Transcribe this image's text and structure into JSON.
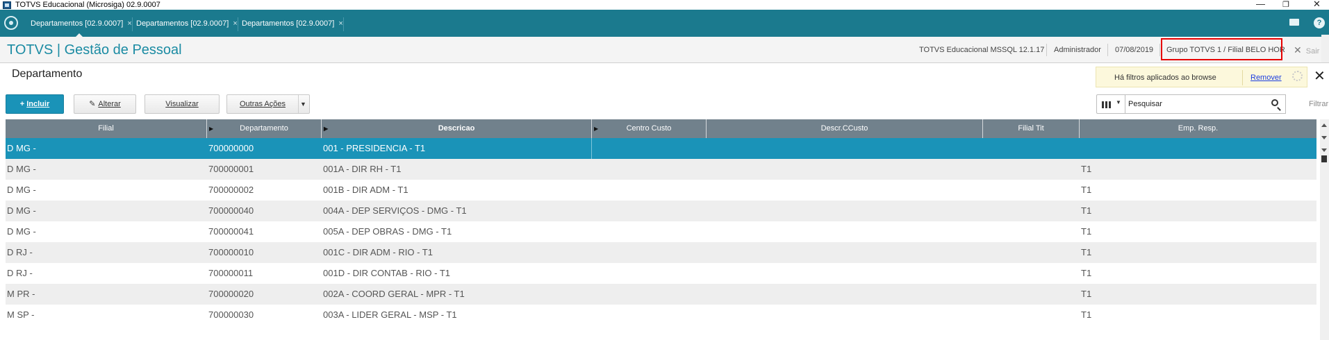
{
  "window": {
    "title": "TOTVS Educacional (Microsiga) 02.9.0007"
  },
  "tabs": [
    {
      "label": "Departamentos [02.9.0007]",
      "active": true
    },
    {
      "label": "Departamentos [02.9.0007]",
      "active": false
    },
    {
      "label": "Departamentos [02.9.0007]",
      "active": false
    }
  ],
  "tab_close": "×",
  "header": {
    "brand": "TOTVS | Gestão de Pessoal",
    "environment": "TOTVS Educacional MSSQL 12.1.17",
    "user": "Administrador",
    "date": "07/08/2019",
    "group_branch": "Grupo TOTVS 1 / Filial BELO HOR",
    "exit_label": "Sair"
  },
  "page": {
    "title": "Departamento",
    "filter_notice": "Há filtros aplicados ao browse",
    "remove_label": "Remover"
  },
  "toolbar": {
    "include": "Incluir",
    "edit": "Alterar",
    "view": "Visualizar",
    "other_actions": "Outras Ações"
  },
  "search": {
    "placeholder": "Pesquisar",
    "filter_label": "Filtrar"
  },
  "grid": {
    "columns": [
      "Filial",
      "Departamento",
      "Descricao",
      "Centro Custo",
      "Descr.CCusto",
      "Filial Tit",
      "Emp. Resp."
    ],
    "rows": [
      {
        "filial": "D MG    -",
        "departamento": "700000000",
        "descricao": "001 - PRESIDENCIA - T1",
        "centro_custo": "",
        "descr_ccusto": "",
        "filial_tit": "",
        "emp_resp": "",
        "selected": true
      },
      {
        "filial": "D MG    -",
        "departamento": "700000001",
        "descricao": "001A - DIR RH - T1",
        "centro_custo": "",
        "descr_ccusto": "",
        "filial_tit": "",
        "emp_resp": "T1"
      },
      {
        "filial": "D MG    -",
        "departamento": "700000002",
        "descricao": "001B - DIR ADM -  T1",
        "centro_custo": "",
        "descr_ccusto": "",
        "filial_tit": "",
        "emp_resp": "T1"
      },
      {
        "filial": "D MG    -",
        "departamento": "700000040",
        "descricao": "004A - DEP SERVIÇOS - DMG - T1",
        "centro_custo": "",
        "descr_ccusto": "",
        "filial_tit": "",
        "emp_resp": "T1"
      },
      {
        "filial": "D MG    -",
        "departamento": "700000041",
        "descricao": "005A - DEP OBRAS - DMG - T1",
        "centro_custo": "",
        "descr_ccusto": "",
        "filial_tit": "",
        "emp_resp": "T1"
      },
      {
        "filial": "D RJ    -",
        "departamento": "700000010",
        "descricao": "001C - DIR ADM - RIO - T1",
        "centro_custo": "",
        "descr_ccusto": "",
        "filial_tit": "",
        "emp_resp": "T1"
      },
      {
        "filial": "D RJ    -",
        "departamento": "700000011",
        "descricao": "001D - DIR CONTAB - RIO - T1",
        "centro_custo": "",
        "descr_ccusto": "",
        "filial_tit": "",
        "emp_resp": "T1"
      },
      {
        "filial": "M PR    -",
        "departamento": "700000020",
        "descricao": "002A - COORD GERAL - MPR - T1",
        "centro_custo": "",
        "descr_ccusto": "",
        "filial_tit": "",
        "emp_resp": "T1"
      },
      {
        "filial": "M SP    -",
        "departamento": "700000030",
        "descricao": "003A - LIDER GERAL - MSP - T1",
        "centro_custo": "",
        "descr_ccusto": "",
        "filial_tit": "",
        "emp_resp": "T1"
      }
    ]
  },
  "colors": {
    "tabbar": "#1b7a8e",
    "brand": "#1b8ba3",
    "selected_row": "#1a93b8",
    "grid_header": "#71818c",
    "highlight": "#e60000"
  }
}
